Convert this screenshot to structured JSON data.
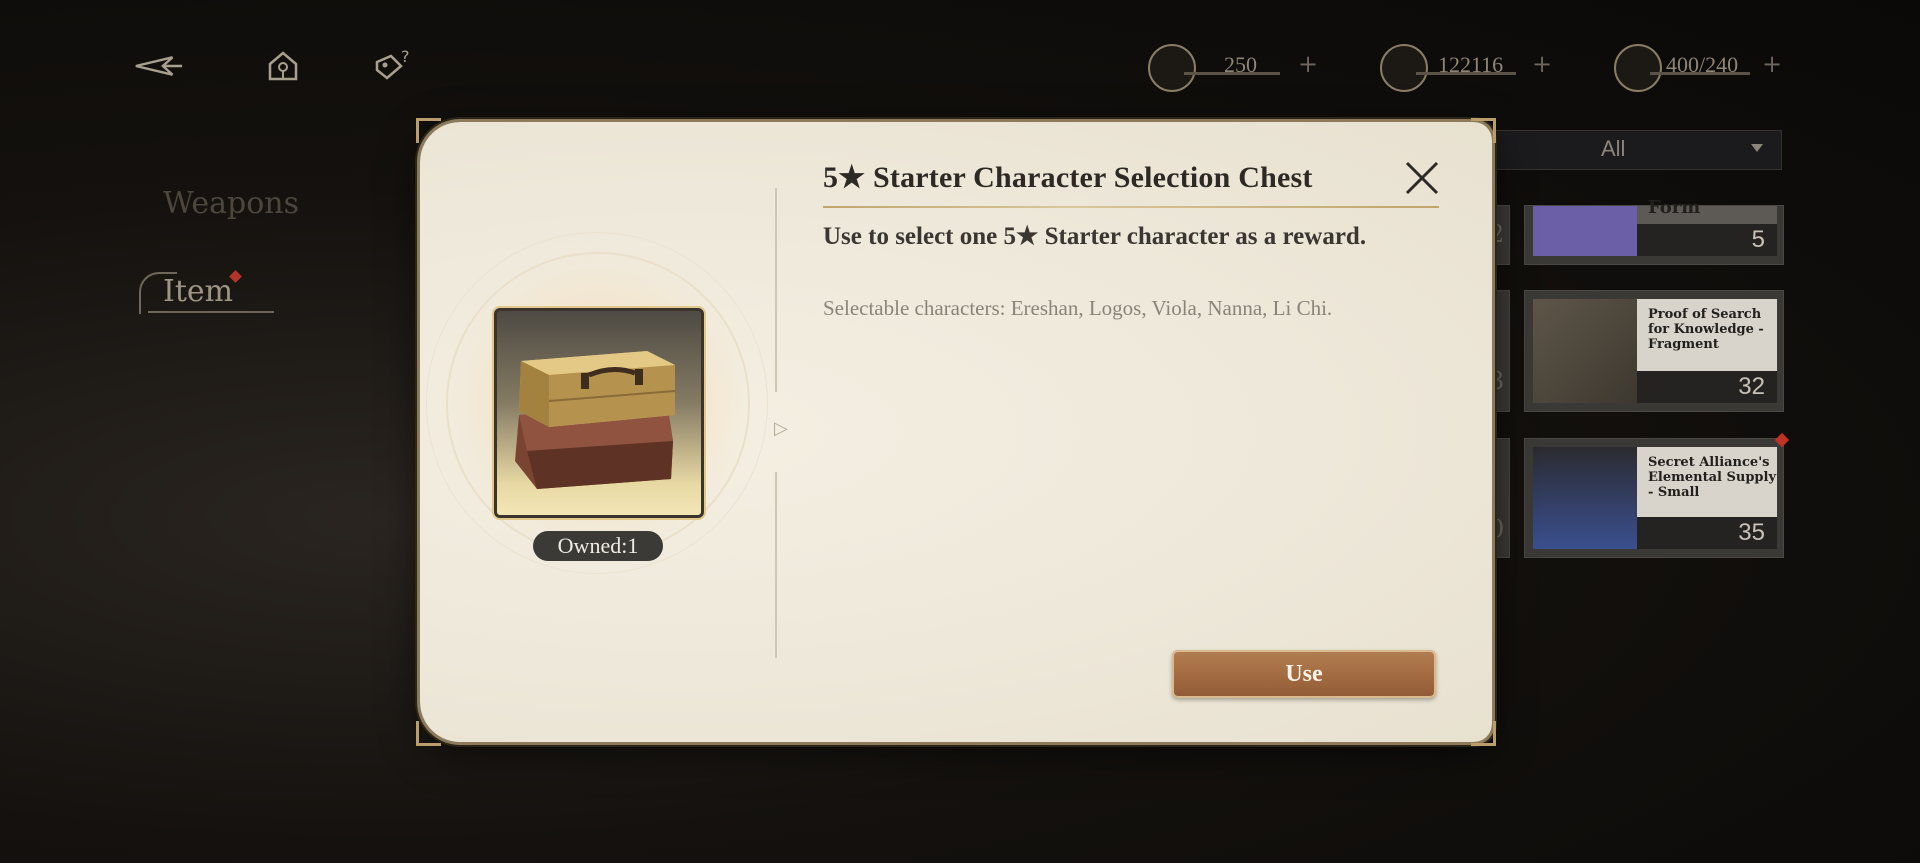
{
  "top_bar": {
    "icons": [
      "back-arrow-icon",
      "home-icon",
      "tag-help-icon"
    ],
    "resources": [
      {
        "name": "stamina",
        "icon": "quill-icon",
        "value": "250",
        "plus": "+"
      },
      {
        "name": "coins",
        "icon": "coin-icon",
        "value": "122116",
        "plus": "+"
      },
      {
        "name": "capacity",
        "icon": "lantern-icon",
        "value": "400/240",
        "plus": "+"
      }
    ]
  },
  "sidebar": {
    "items": [
      {
        "label": "Weapons"
      },
      {
        "label": "Item"
      }
    ]
  },
  "inventory": {
    "filter": {
      "label": "All"
    },
    "cards": [
      {
        "name": "Form",
        "count": "5"
      },
      {
        "name": "Proof of Search for Knowledge - Fragment",
        "count": "32"
      },
      {
        "name": "Secret Alliance's Elemental Supply - Small",
        "count": "35"
      }
    ],
    "partial_counts": [
      "2",
      "3",
      "0"
    ]
  },
  "dialog": {
    "title": "5★ Starter Character Selection Chest",
    "description": "Use to select one 5★ Starter character as a reward.",
    "selectable": "Selectable characters: Ereshan, Logos, Viola, Nanna, Li Chi.",
    "owned": "Owned:1",
    "use_label": "Use",
    "item_icon": "suitcase-chest-icon"
  },
  "colors": {
    "dialog_bg": "#f0ebdf",
    "accent_gold": "#bfa56b",
    "use_button": "#a46c43",
    "new_dot": "#c2302a"
  }
}
